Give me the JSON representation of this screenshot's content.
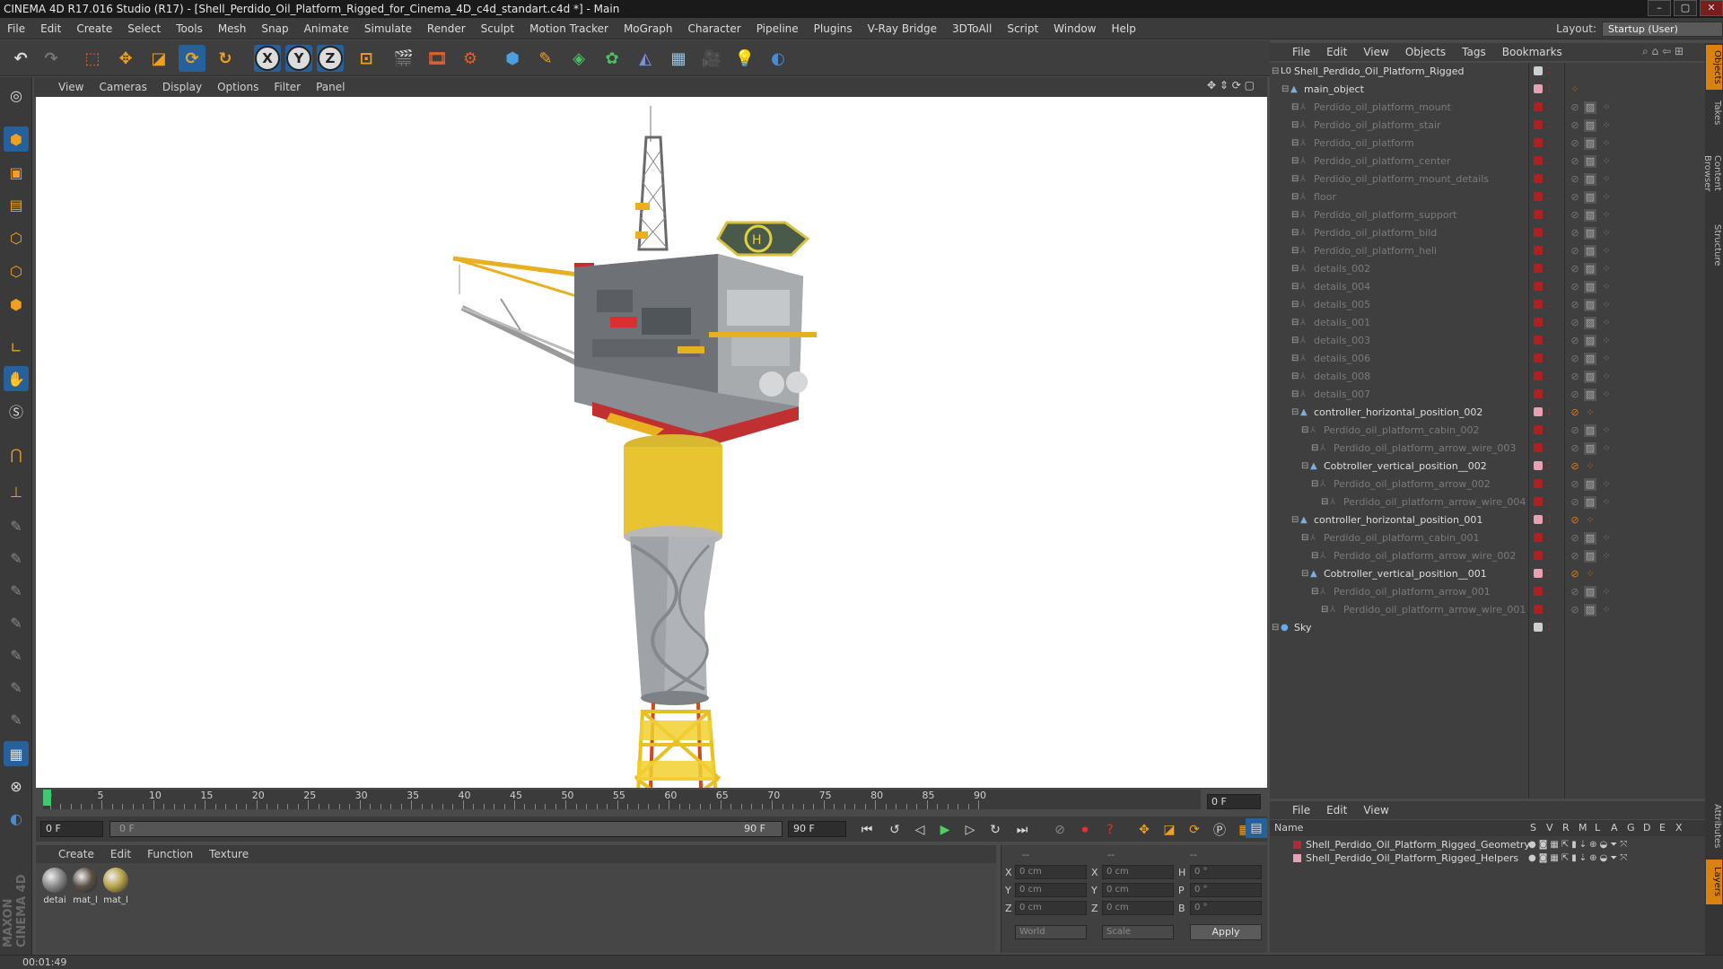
{
  "window": {
    "title": "CINEMA 4D R17.016 Studio (R17) - [Shell_Perdido_Oil_Platform_Rigged_for_Cinema_4D_c4d_standart.c4d *] - Main"
  },
  "menubar": [
    "File",
    "Edit",
    "Create",
    "Select",
    "Tools",
    "Mesh",
    "Snap",
    "Animate",
    "Simulate",
    "Render",
    "Sculpt",
    "Motion Tracker",
    "MoGraph",
    "Character",
    "Pipeline",
    "Plugins",
    "V-Ray Bridge",
    "3DToAll",
    "Script",
    "Window",
    "Help"
  ],
  "layout": {
    "label": "Layout:",
    "value": "Startup (User)"
  },
  "viewport_menu": [
    "View",
    "Cameras",
    "Display",
    "Options",
    "Filter",
    "Panel"
  ],
  "timeline": {
    "ticks": [
      "0",
      "5",
      "10",
      "15",
      "20",
      "25",
      "30",
      "35",
      "40",
      "45",
      "50",
      "55",
      "60",
      "65",
      "70",
      "75",
      "80",
      "85",
      "90"
    ],
    "current_frame": "0 F",
    "start_frame": "0 F",
    "range_start": "0 F",
    "range_end": "90 F",
    "end_frame": "90 F",
    "right_frame": "0 F"
  },
  "material_menu": [
    "Create",
    "Edit",
    "Function",
    "Texture"
  ],
  "materials": [
    {
      "label": "detai",
      "color": "#8a8a8a"
    },
    {
      "label": "mat_l",
      "color": "#5b5048"
    },
    {
      "label": "mat_l",
      "color": "#b9a24a"
    }
  ],
  "coords": {
    "header": [
      "--",
      "--",
      "--"
    ],
    "rows": [
      {
        "a": "X",
        "v1": "0 cm",
        "b": "X",
        "v2": "0 cm",
        "c": "H",
        "v3": "0 °"
      },
      {
        "a": "Y",
        "v1": "0 cm",
        "b": "Y",
        "v2": "0 cm",
        "c": "P",
        "v3": "0 °"
      },
      {
        "a": "Z",
        "v1": "0 cm",
        "b": "Z",
        "v2": "0 cm",
        "c": "B",
        "v3": "0 °"
      }
    ],
    "mode": "World",
    "scale": "Scale",
    "apply": "Apply"
  },
  "status_time": "00:01:49",
  "object_menu": [
    "File",
    "Edit",
    "View",
    "Objects",
    "Tags",
    "Bookmarks"
  ],
  "objects": [
    {
      "name": "Shell_Perdido_Oil_Platform_Rigged",
      "depth": 0,
      "active": true,
      "icon": "layer",
      "dot": "#cfcfcf"
    },
    {
      "name": "main_object",
      "depth": 1,
      "active": true,
      "icon": "null",
      "dot": "#e8a0b4"
    },
    {
      "name": "Perdido_oil_platform_mount",
      "depth": 2,
      "active": false,
      "icon": "bone",
      "dot": "#b02020"
    },
    {
      "name": "Perdido_oil_platform_stair",
      "depth": 2,
      "active": false,
      "icon": "bone",
      "dot": "#b02020"
    },
    {
      "name": "Perdido_oil_platform",
      "depth": 2,
      "active": false,
      "icon": "bone",
      "dot": "#b02020"
    },
    {
      "name": "Perdido_oil_platform_center",
      "depth": 2,
      "active": false,
      "icon": "bone",
      "dot": "#b02020"
    },
    {
      "name": "Perdido_oil_platform_mount_details",
      "depth": 2,
      "active": false,
      "icon": "bone",
      "dot": "#b02020"
    },
    {
      "name": "floor",
      "depth": 2,
      "active": false,
      "icon": "bone",
      "dot": "#b02020"
    },
    {
      "name": "Perdido_oil_platform_support",
      "depth": 2,
      "active": false,
      "icon": "bone",
      "dot": "#b02020"
    },
    {
      "name": "Perdido_oil_platform_bild",
      "depth": 2,
      "active": false,
      "icon": "bone",
      "dot": "#b02020"
    },
    {
      "name": "Perdido_oil_platform_heli",
      "depth": 2,
      "active": false,
      "icon": "bone",
      "dot": "#b02020"
    },
    {
      "name": "details_002",
      "depth": 2,
      "active": false,
      "icon": "bone",
      "dot": "#b02020"
    },
    {
      "name": "details_004",
      "depth": 2,
      "active": false,
      "icon": "bone",
      "dot": "#b02020"
    },
    {
      "name": "details_005",
      "depth": 2,
      "active": false,
      "icon": "bone",
      "dot": "#b02020"
    },
    {
      "name": "details_001",
      "depth": 2,
      "active": false,
      "icon": "bone",
      "dot": "#b02020"
    },
    {
      "name": "details_003",
      "depth": 2,
      "active": false,
      "icon": "bone",
      "dot": "#b02020"
    },
    {
      "name": "details_006",
      "depth": 2,
      "active": false,
      "icon": "bone",
      "dot": "#b02020"
    },
    {
      "name": "details_008",
      "depth": 2,
      "active": false,
      "icon": "bone",
      "dot": "#b02020"
    },
    {
      "name": "details_007",
      "depth": 2,
      "active": false,
      "icon": "bone",
      "dot": "#b02020"
    },
    {
      "name": "controller_horizontal_position_002",
      "depth": 2,
      "active": true,
      "icon": "null",
      "dot": "#e8a0b4"
    },
    {
      "name": "Perdido_oil_platform_cabin_002",
      "depth": 3,
      "active": false,
      "icon": "bone",
      "dot": "#b02020"
    },
    {
      "name": "Perdido_oil_platform_arrow_wire_003",
      "depth": 4,
      "active": false,
      "icon": "bone",
      "dot": "#b02020"
    },
    {
      "name": "Cobtroller_vertical_position__002",
      "depth": 3,
      "active": true,
      "icon": "null",
      "dot": "#e8a0b4"
    },
    {
      "name": "Perdido_oil_platform_arrow_002",
      "depth": 4,
      "active": false,
      "icon": "bone",
      "dot": "#b02020"
    },
    {
      "name": "Perdido_oil_platform_arrow_wire_004",
      "depth": 5,
      "active": false,
      "icon": "bone",
      "dot": "#b02020"
    },
    {
      "name": "controller_horizontal_position_001",
      "depth": 2,
      "active": true,
      "icon": "null",
      "dot": "#e8a0b4"
    },
    {
      "name": "Perdido_oil_platform_cabin_001",
      "depth": 3,
      "active": false,
      "icon": "bone",
      "dot": "#b02020"
    },
    {
      "name": "Perdido_oil_platform_arrow_wire_002",
      "depth": 4,
      "active": false,
      "icon": "bone",
      "dot": "#b02020"
    },
    {
      "name": "Cobtroller_vertical_position__001",
      "depth": 3,
      "active": true,
      "icon": "null",
      "dot": "#e8a0b4"
    },
    {
      "name": "Perdido_oil_platform_arrow_001",
      "depth": 4,
      "active": false,
      "icon": "bone",
      "dot": "#b02020"
    },
    {
      "name": "Perdido_oil_platform_arrow_wire_001",
      "depth": 5,
      "active": false,
      "icon": "bone",
      "dot": "#b02020"
    },
    {
      "name": "Sky",
      "depth": 0,
      "active": true,
      "icon": "sky",
      "dot": "#cfcfcf"
    }
  ],
  "layers_menu": [
    "File",
    "Edit",
    "View"
  ],
  "layers_header": {
    "name": "Name",
    "cols": [
      "S",
      "V",
      "R",
      "M",
      "L",
      "A",
      "G",
      "D",
      "E",
      "X"
    ]
  },
  "layers": [
    {
      "name": "Shell_Perdido_Oil_Platform_Rigged_Geometry",
      "color": "#b0283a"
    },
    {
      "name": "Shell_Perdido_Oil_Platform_Rigged_Helpers",
      "color": "#e8a0b4"
    }
  ],
  "right_tabs": [
    "Objects",
    "Takes",
    "Content Browser",
    "Structure",
    "Attributes",
    "Layers"
  ],
  "colors": {
    "accent": "#26619c",
    "highlight": "#d9820f",
    "viewport_bg": "#ffffff"
  }
}
